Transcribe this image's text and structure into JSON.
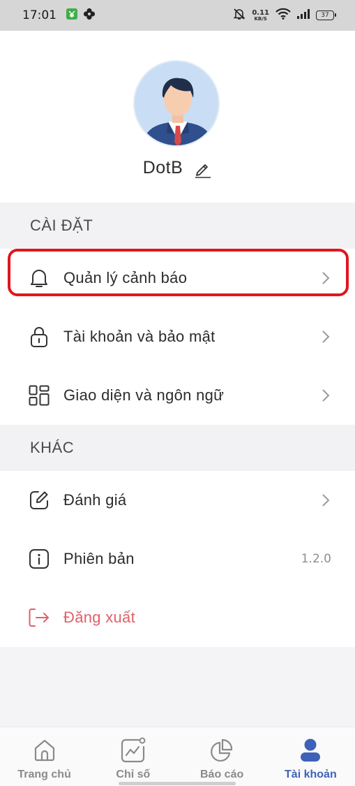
{
  "status_bar": {
    "time": "17:01",
    "net_speed": "0.11",
    "net_unit": "KB/S",
    "battery": "37"
  },
  "profile": {
    "username": "DotB"
  },
  "sections": {
    "settings_title": "CÀI ĐẶT",
    "other_title": "KHÁC"
  },
  "settings_items": [
    {
      "label": "Quản lý cảnh báo",
      "icon": "bell-icon"
    },
    {
      "label": "Tài khoản và bảo mật",
      "icon": "lock-icon"
    },
    {
      "label": "Giao diện và ngôn ngữ",
      "icon": "layout-icon"
    }
  ],
  "other_items": [
    {
      "label": "Đánh giá",
      "icon": "edit-square-icon"
    },
    {
      "label": "Phiên bản",
      "icon": "info-icon",
      "value": "1.2.0"
    },
    {
      "label": "Đăng xuất",
      "icon": "logout-icon"
    }
  ],
  "bottom_nav": [
    {
      "label": "Trang chủ",
      "icon": "home-icon",
      "active": false
    },
    {
      "label": "Chỉ số",
      "icon": "chart-icon",
      "active": false
    },
    {
      "label": "Báo cáo",
      "icon": "pie-chart-icon",
      "active": false
    },
    {
      "label": "Tài khoản",
      "icon": "user-icon",
      "active": true
    }
  ],
  "colors": {
    "accent": "#3e62b8",
    "logout": "#e0606a",
    "highlight": "#e2151d",
    "avatar_bg": "#c9def5"
  }
}
